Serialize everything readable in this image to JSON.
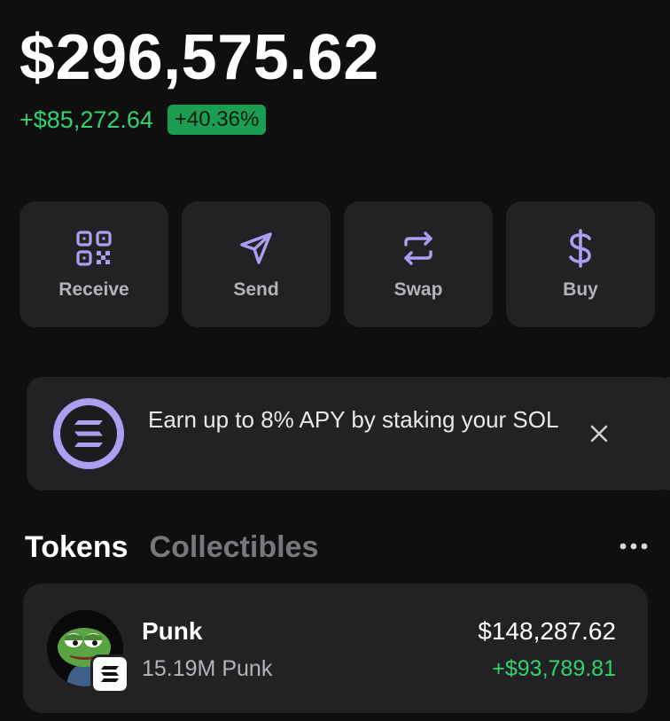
{
  "portfolio": {
    "balance": "$296,575.62",
    "change_amount": "+$85,272.64",
    "change_percent": "+40.36%",
    "positive_color": "#2fd36f"
  },
  "actions": [
    {
      "label": "Receive",
      "icon": "qr-code-icon"
    },
    {
      "label": "Send",
      "icon": "send-icon"
    },
    {
      "label": "Swap",
      "icon": "swap-icon"
    },
    {
      "label": "Buy",
      "icon": "dollar-icon"
    }
  ],
  "accent_color": "#ab9ff2",
  "banner": {
    "text": "Earn up to 8% APY by staking your SOL",
    "icon": "solana-logo-icon",
    "close_icon": "close-icon"
  },
  "tabs": {
    "active": "Tokens",
    "inactive": "Collectibles",
    "more_icon": "more-icon"
  },
  "tokens": [
    {
      "name": "Punk",
      "amount": "15.19M Punk",
      "value": "$148,287.62",
      "change": "+$93,789.81",
      "avatar": "pepe-avatar",
      "chain_badge": "solana-badge-icon"
    }
  ]
}
